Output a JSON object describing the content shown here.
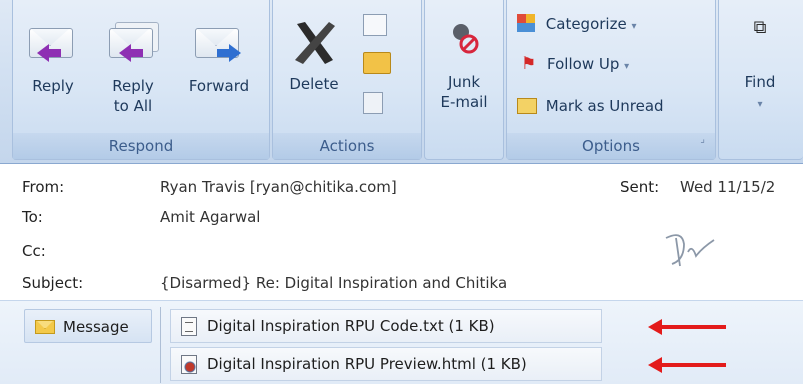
{
  "ribbon": {
    "respond": {
      "label": "Respond",
      "reply": "Reply",
      "reply_all_1": "Reply",
      "reply_all_2": "to All",
      "forward": "Forward"
    },
    "actions": {
      "label": "Actions",
      "delete": "Delete"
    },
    "junk": {
      "line1": "Junk",
      "line2": "E-mail"
    },
    "options": {
      "label": "Options",
      "categorize": "Categorize",
      "follow_up": "Follow Up",
      "mark_unread": "Mark as Unread"
    },
    "find": {
      "label": "Find"
    }
  },
  "header": {
    "from_label": "From:",
    "from_value": "Ryan Travis [ryan@chitika.com]",
    "to_label": "To:",
    "to_value": "Amit Agarwal",
    "cc_label": "Cc:",
    "subject_label": "Subject:",
    "subject_value": "{Disarmed} Re: Digital Inspiration and Chitika",
    "sent_label": "Sent:",
    "sent_value": "Wed 11/15/2"
  },
  "attachments": {
    "message_label": "Message",
    "items": [
      {
        "name": "Digital Inspiration RPU Code.txt (1 KB)"
      },
      {
        "name": "Digital Inspiration RPU Preview.html (1 KB)"
      }
    ]
  },
  "colors": {
    "annotation_arrow": "#e31b1b",
    "ribbon_text": "#1e395b"
  }
}
